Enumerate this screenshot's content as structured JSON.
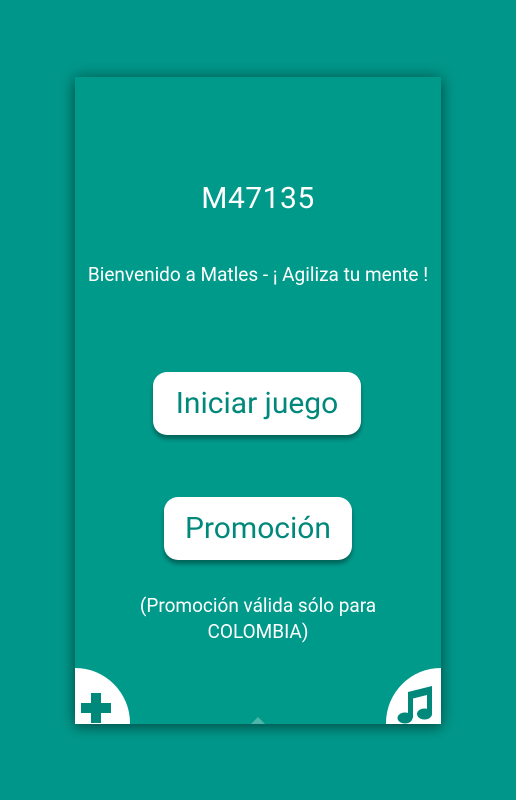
{
  "screen": {
    "background_color": "#00978a",
    "dialog_color": "#009a8b",
    "button_color": "#ffffff",
    "button_text_color": "#00897b"
  },
  "app": {
    "code": "M47135",
    "welcome_text": "Bienvenido a Matles - ¡ Agiliza tu mente !"
  },
  "buttons": {
    "start_label": "Iniciar juego",
    "promo_label": "Promoción"
  },
  "promo_note": {
    "line1": "(Promoción válida sólo para",
    "line2": "COLOMBIA)"
  },
  "icons": {
    "add": "plus-icon",
    "music": "music-note-icon",
    "scroll": "chevron-up-icon"
  }
}
